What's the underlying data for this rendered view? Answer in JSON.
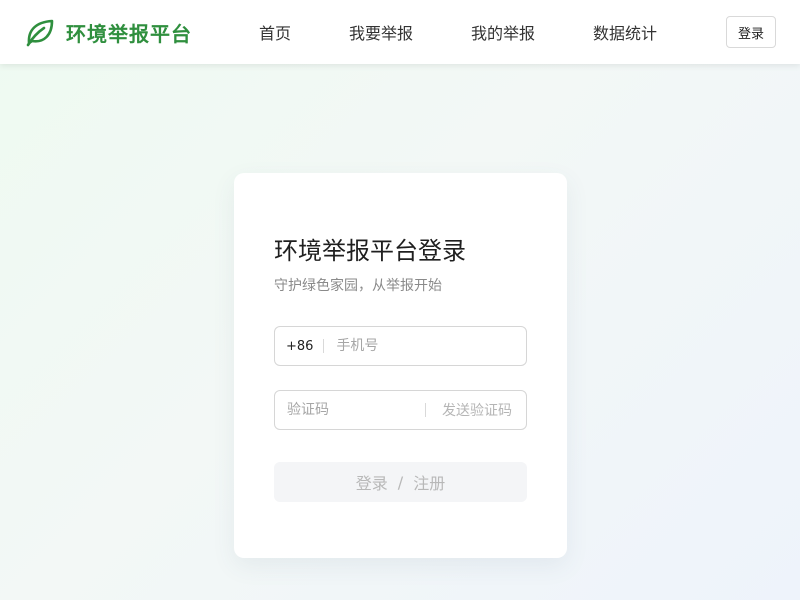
{
  "header": {
    "brand_name": "环境举报平台",
    "brand_logo_icon": "leaf-icon",
    "brand_color": "#2f8f3e",
    "nav": [
      {
        "label": "首页"
      },
      {
        "label": "我要举报"
      },
      {
        "label": "我的举报"
      },
      {
        "label": "数据统计"
      }
    ],
    "login_label": "登录"
  },
  "login": {
    "title": "环境举报平台登录",
    "subtitle": "守护绿色家园，从举报开始",
    "phone": {
      "prefix": "+86",
      "placeholder": "手机号",
      "value": ""
    },
    "code": {
      "placeholder": "验证码",
      "value": "",
      "send_label": "发送验证码"
    },
    "submit": {
      "login_label": "登录",
      "separator": "/",
      "register_label": "注册"
    }
  }
}
